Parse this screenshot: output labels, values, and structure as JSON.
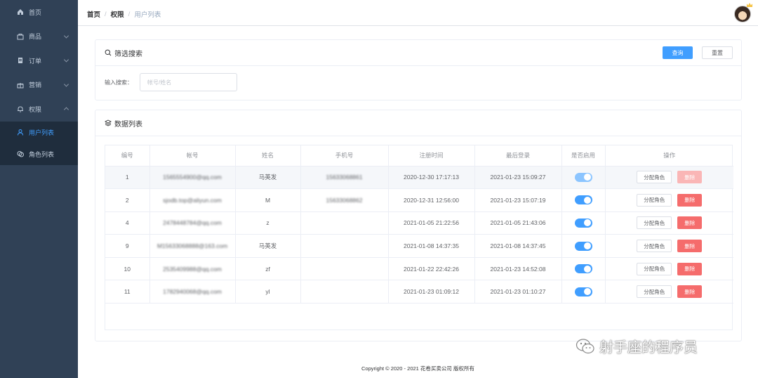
{
  "sidebar": {
    "items": [
      {
        "label": "首页",
        "icon": "home-icon"
      },
      {
        "label": "商品",
        "icon": "goods-icon"
      },
      {
        "label": "订单",
        "icon": "order-icon"
      },
      {
        "label": "营销",
        "icon": "gift-icon"
      },
      {
        "label": "权限",
        "icon": "bell-icon"
      }
    ],
    "submenu": [
      {
        "label": "用户列表",
        "icon": "user-icon",
        "active": true
      },
      {
        "label": "角色列表",
        "icon": "roles-icon",
        "active": false
      }
    ],
    "colors": {
      "background": "#304156",
      "submenu_background": "#1f2d3d",
      "active": "#409eff",
      "text": "#bfcbd9"
    }
  },
  "header": {
    "breadcrumb": [
      "首页",
      "权限",
      "用户列表"
    ],
    "breadcrumb_sep": "/"
  },
  "filter": {
    "title": "筛选搜索",
    "query_button": "查询",
    "reset_button": "重置",
    "search_label": "输入搜索：",
    "search_placeholder": "帐号/姓名",
    "search_value": ""
  },
  "data_list": {
    "title": "数据列表",
    "columns": [
      "编号",
      "帐号",
      "姓名",
      "手机号",
      "注册时间",
      "最后登录",
      "是否启用",
      "操作"
    ],
    "assign_label": "分配角色",
    "delete_label": "删除",
    "rows": [
      {
        "id": "1",
        "account": "1565554900@qq.com",
        "name": "马英发",
        "phone": "15633068861",
        "registered": "2020-12-30 17:17:13",
        "last_login": "2021-01-23 15:09:27",
        "enabled": true
      },
      {
        "id": "2",
        "account": "sjodb.top@aliyun.com",
        "name": "M",
        "phone": "15633068862",
        "registered": "2020-12-31 12:56:00",
        "last_login": "2021-01-23 15:07:19",
        "enabled": true
      },
      {
        "id": "4",
        "account": "2478448784@qq.com",
        "name": "z",
        "phone": "",
        "registered": "2021-01-05 21:22:56",
        "last_login": "2021-01-05 21:43:06",
        "enabled": true
      },
      {
        "id": "9",
        "account": "M15633068888@163.com",
        "name": "马英发",
        "phone": "",
        "registered": "2021-01-08 14:37:35",
        "last_login": "2021-01-08 14:37:45",
        "enabled": true
      },
      {
        "id": "10",
        "account": "2535409988@qq.com",
        "name": "zf",
        "phone": "",
        "registered": "2021-01-22 22:42:26",
        "last_login": "2021-01-23 14:52:08",
        "enabled": true
      },
      {
        "id": "11",
        "account": "1782940068@qq.com",
        "name": "yl",
        "phone": "",
        "registered": "2021-01-23 01:09:12",
        "last_login": "2021-01-23 01:10:27",
        "enabled": true
      }
    ]
  },
  "footer": {
    "text": "Copyright © 2020 - 2021  花卷买卖公司 版权所有"
  },
  "watermark": {
    "text": "射手座的程序员",
    "icon": "wechat-icon"
  }
}
